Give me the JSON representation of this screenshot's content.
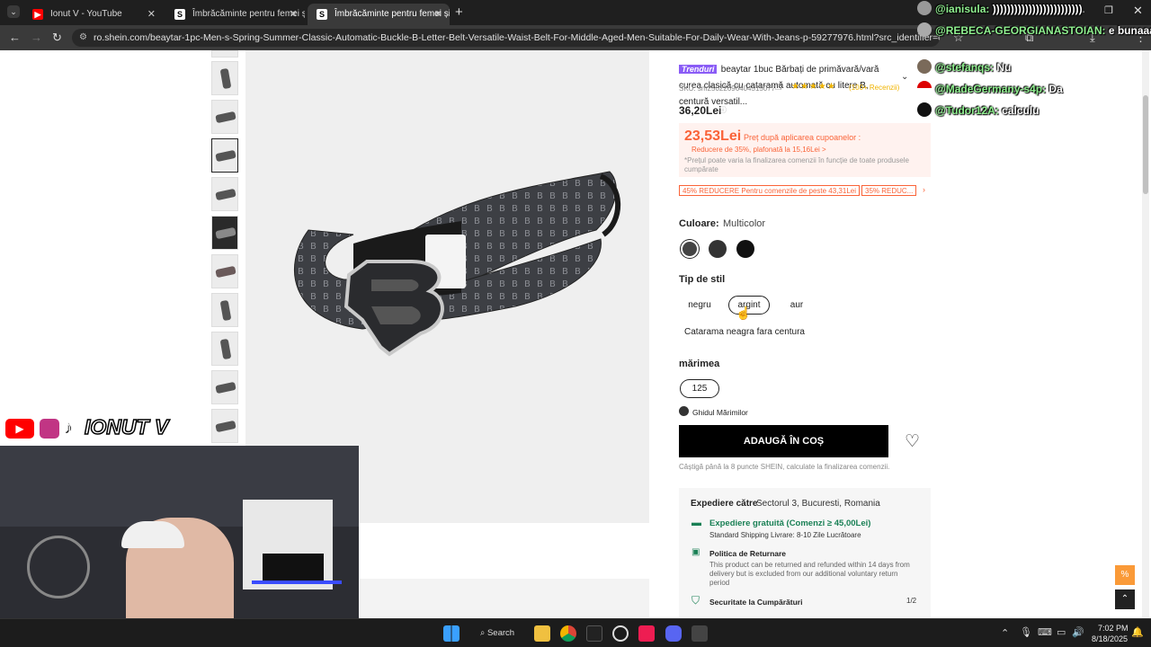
{
  "browser": {
    "tabs": [
      {
        "title": "Ionut V - YouTube",
        "active": false
      },
      {
        "title": "Îmbrăcăminte pentru femei și b",
        "active": false
      },
      {
        "title": "Îmbrăcăminte pentru femei și b",
        "active": true
      }
    ],
    "url": "ro.shein.com/beaytar-1pc-Men-s-Spring-Summer-Classic-Automatic-Buckle-B-Letter-Belt-Versatile-Waist-Belt-For-Middle-Aged-Men-Suitable-For-Daily-Wear-With-Jeans-p-59277976.html?src_identifier=on%3DIMAGE_COMPO..."
  },
  "product": {
    "badge": "Trenduri",
    "title": "beaytar 1buc Bărbați de primăvară/vară curea clasică cu cataramă automată cu litere B, centură versatil...",
    "sku": "SKU: sm25022696404515077",
    "reviews": "(100+ Recenzii)",
    "rating": 4.5,
    "price": "36,20Lei",
    "promo_price": "23,53Lei",
    "promo_label": "Preț după aplicarea cupoanelor :",
    "promo_discount": "Reducere de 35%, plafonată la 15,16Lei >",
    "promo_note": "*Prețul poate varia la finalizarea comenzii în funcție de toate produsele cumpărate",
    "coupons": [
      "45% REDUCERE Pentru comenzile de peste 43,31Lei",
      "35% REDUC..."
    ],
    "color_label": "Culoare:",
    "color_value": "Multicolor",
    "style_label": "Tip de stil",
    "style_options": [
      "negru",
      "argint",
      "aur",
      "Catarama neagra fara centura"
    ],
    "style_selected": 1,
    "size_label": "mărimea",
    "size_options": [
      "125"
    ],
    "size_guide": "Ghidul Mărimilor",
    "add_to_cart": "ADAUGĂ ÎN COȘ",
    "points_note": "Câștigă până la 8 puncte SHEIN, calculate la finalizarea comenzii.",
    "shipping": {
      "label": "Expediere către",
      "destination": "Sectorul 3, Bucuresti, Romania",
      "free": "Expediere gratuită (Comenzi ≥ 45,00Lei)",
      "standard": "Standard Shipping Livrare: 8-10 Zile Lucrătoare",
      "return_title": "Politica de Returnare",
      "return_text": "This product can be returned and refunded within 14 days from delivery but is excluded from our additional voluntary return period",
      "security": "Securitate la Cumpărături",
      "security_page": "1/2"
    }
  },
  "overlay": {
    "channel_name": "IONUT V",
    "chat": [
      {
        "user": "@ianisula:",
        "msg": ")))))))))))))))))))))))))"
      },
      {
        "user": "@REBECA-GEORGIANASTOIAN:",
        "msg": "e bunaaa"
      },
      {
        "user": "@stefanqs:",
        "msg": "Nu"
      },
      {
        "user": "@MadeGermany-s4p:",
        "msg": "Da"
      },
      {
        "user": "@Tudor12A:",
        "msg": "calculu"
      }
    ]
  },
  "taskbar": {
    "search_label": "Search",
    "time": "7:02 PM",
    "date": "8/18/2025"
  },
  "colors": {
    "promo": "#fa6338",
    "green": "#198055",
    "chat_user": "#90f090"
  }
}
